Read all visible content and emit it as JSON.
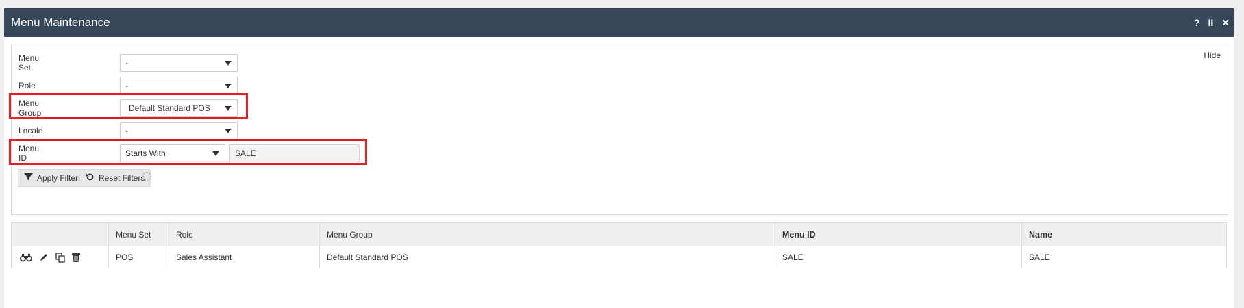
{
  "window": {
    "title": "Menu Maintenance",
    "help_glyph": "?",
    "pause_glyph": "II",
    "close_glyph": "✕"
  },
  "filters": {
    "hide_label": "Hide",
    "menu_set": {
      "label": "Menu Set",
      "value": "-"
    },
    "role": {
      "label": "Role",
      "value": "-"
    },
    "menu_group": {
      "label": "Menu Group",
      "value": "Default Standard POS"
    },
    "locale": {
      "label": "Locale",
      "value": "-"
    },
    "menu_id": {
      "label": "Menu ID",
      "operator": "Starts With",
      "value": "SALE"
    },
    "apply_label": "Apply Filters",
    "reset_label": "Reset Filters"
  },
  "table": {
    "columns": [
      "",
      "Menu Set",
      "Role",
      "Menu Group",
      "Menu ID",
      "Name"
    ],
    "rows": [
      {
        "menu_set": "POS",
        "role": "Sales Assistant",
        "menu_group": "Default Standard POS",
        "menu_id": "SALE",
        "name": "SALE"
      }
    ]
  },
  "icons": {
    "view": "binoculars-icon",
    "edit": "pencil-icon",
    "copy": "copy-icon",
    "delete": "trash-icon",
    "filter": "filter-icon",
    "reset": "refresh-icon"
  },
  "colors": {
    "titlebar": "#36475a",
    "highlight": "#e02020"
  }
}
